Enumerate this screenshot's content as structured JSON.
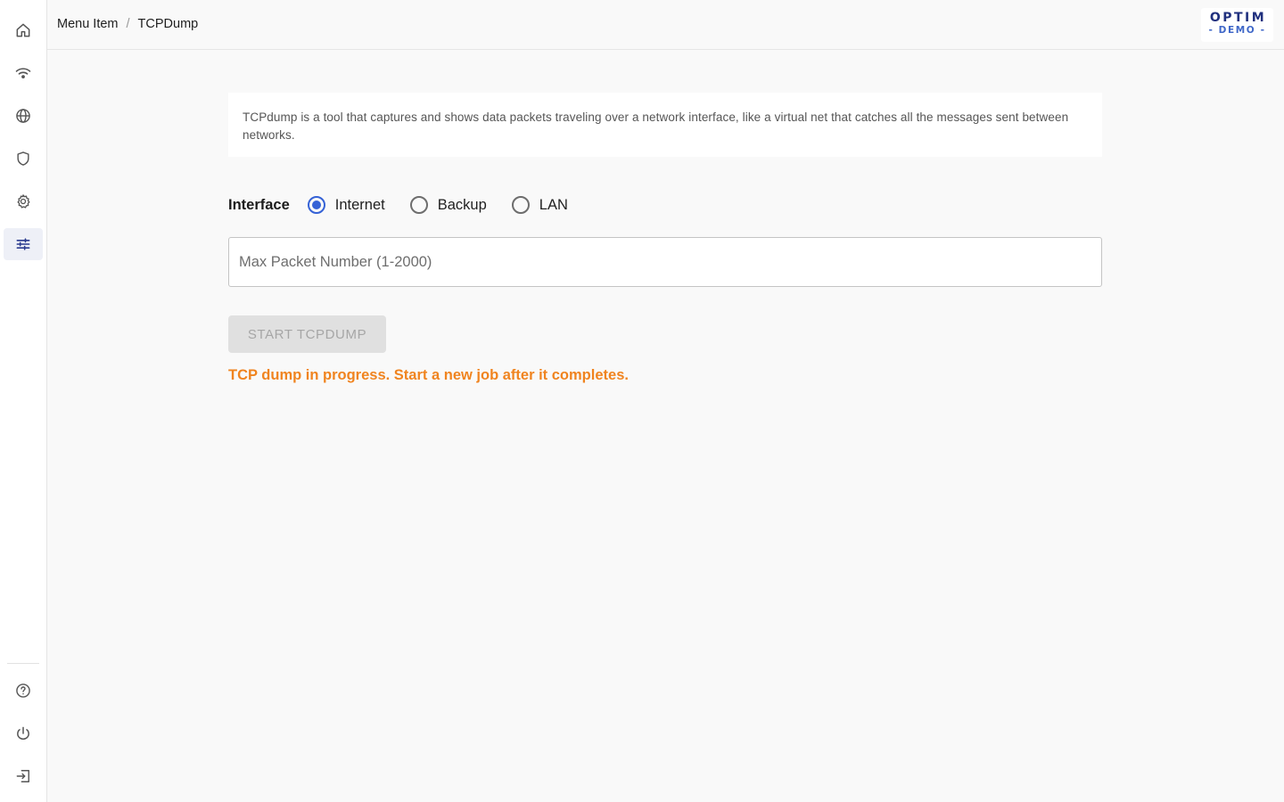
{
  "breadcrumb": {
    "parent": "Menu Item",
    "separator": "/",
    "current": "TCPDump"
  },
  "logo": {
    "line1": "OPTIM",
    "line2": "- DEMO -"
  },
  "sidebar": {
    "items": [
      {
        "icon": "home-icon",
        "active": false
      },
      {
        "icon": "wifi-icon",
        "active": false
      },
      {
        "icon": "globe-icon",
        "active": false
      },
      {
        "icon": "shield-icon",
        "active": false
      },
      {
        "icon": "gear-icon",
        "active": false
      },
      {
        "icon": "sliders-icon",
        "active": true
      }
    ],
    "bottom_items": [
      {
        "icon": "help-icon"
      },
      {
        "icon": "power-icon"
      },
      {
        "icon": "logout-icon"
      }
    ]
  },
  "description": "TCPdump is a tool that captures and shows data packets traveling over a network interface, like a virtual net that catches all the messages sent between networks.",
  "interface": {
    "label": "Interface",
    "options": [
      {
        "label": "Internet",
        "checked": true
      },
      {
        "label": "Backup",
        "checked": false
      },
      {
        "label": "LAN",
        "checked": false
      }
    ]
  },
  "max_packet": {
    "placeholder": "Max Packet Number (1-2000)",
    "value": ""
  },
  "start_button": {
    "label": "START TCPDUMP",
    "disabled": true
  },
  "status_message": "TCP dump in progress. Start a new job after it completes.",
  "colors": {
    "accent": "#3562d6",
    "warning": "#f0841f",
    "brand_dark": "#20307e",
    "sidebar_active_icon": "#2a3b8f"
  }
}
